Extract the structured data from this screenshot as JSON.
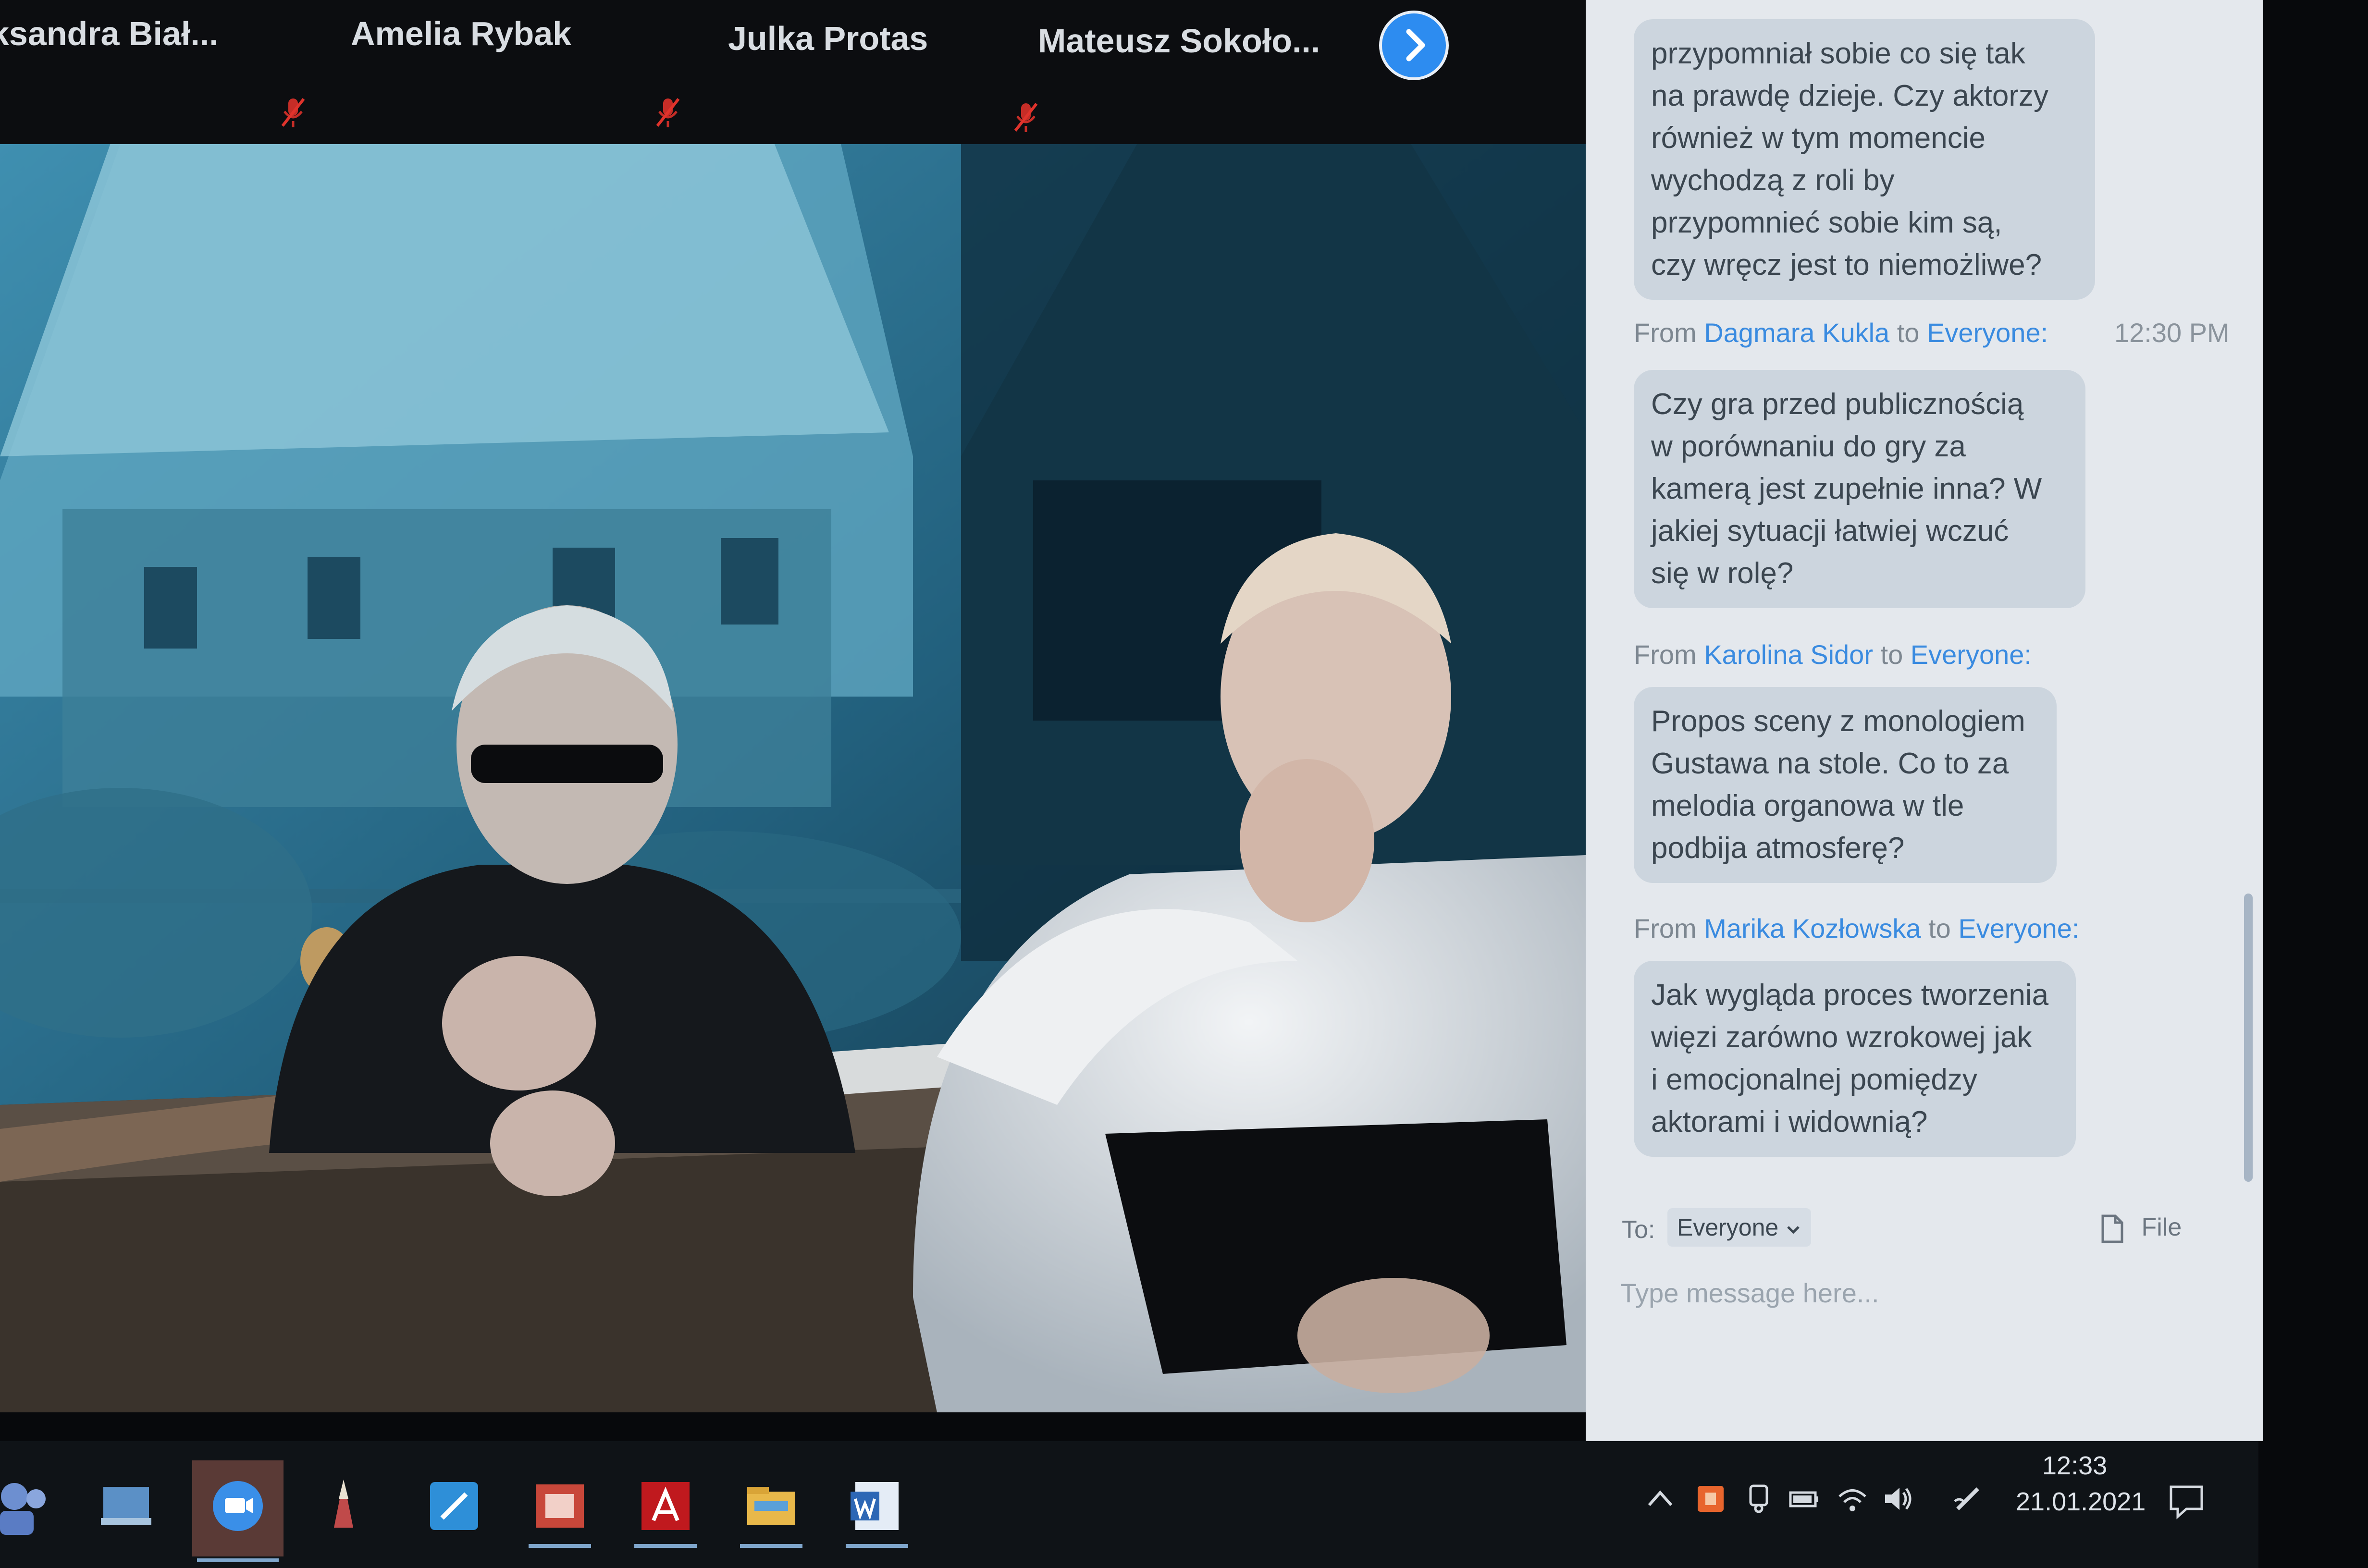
{
  "participants": [
    {
      "name": "ksandra  Biał..."
    },
    {
      "name": "Amelia Rybak"
    },
    {
      "name": "Julka Protas"
    },
    {
      "name": "Mateusz  Sokoło..."
    }
  ],
  "chat": {
    "messages": [
      {
        "text": "przypomniał sobie co się tak\nna prawdę dzieje. Czy aktorzy\nrównież w tym momencie\nwychodzą z roli by\nprzypomnieć sobie kim są,\nczy wręcz jest to niemożliwe?"
      },
      {
        "from_label": "From",
        "sender": "Dagmara Kukla",
        "to_label": "to",
        "recipient": "Everyone:",
        "time": "12:30 PM",
        "text": "Czy gra przed publicznością\nw porównaniu do gry za\nkamerą jest zupełnie inna? W\njakiej sytuacji łatwiej wczuć\nsię w rolę?"
      },
      {
        "from_label": "From",
        "sender": "Karolina Sidor",
        "to_label": "to",
        "recipient": "Everyone:",
        "text": "Propos sceny z monologiem\nGustawa na stole. Co to za\nmelodia organowa w tle\npodbija atmosferę?"
      },
      {
        "from_label": "From",
        "sender": "Marika Kozłowska",
        "to_label": "to",
        "recipient": "Everyone:",
        "text": "Jak wygląda proces tworzenia\nwięzi zarówno wzrokowej jak\ni emocjonalnej pomiędzy\naktorami i widownią?"
      }
    ],
    "compose": {
      "to_label": "To:",
      "recipient": "Everyone",
      "file_label": "File",
      "placeholder": "Type message here..."
    }
  },
  "taskbar": {
    "apps": [
      "teams-icon",
      "desktop-icon",
      "zoom-icon",
      "pencil-icon",
      "notes-icon",
      "powerpoint-icon",
      "acrobat-icon",
      "file-explorer-icon",
      "word-icon"
    ],
    "tray": [
      "chevron-up-icon",
      "antivirus-icon",
      "device-icon",
      "battery-icon",
      "wifi-icon",
      "volume-icon",
      "pen-icon"
    ],
    "time": "12:33",
    "date": "21.01.2021"
  },
  "colors": {
    "accent_blue": "#2d8cf0",
    "link_blue": "#3a8be0",
    "chat_bg": "#e4e8ed",
    "bubble_bg": "#ccd5de",
    "mic_off_red": "#e0332c"
  }
}
